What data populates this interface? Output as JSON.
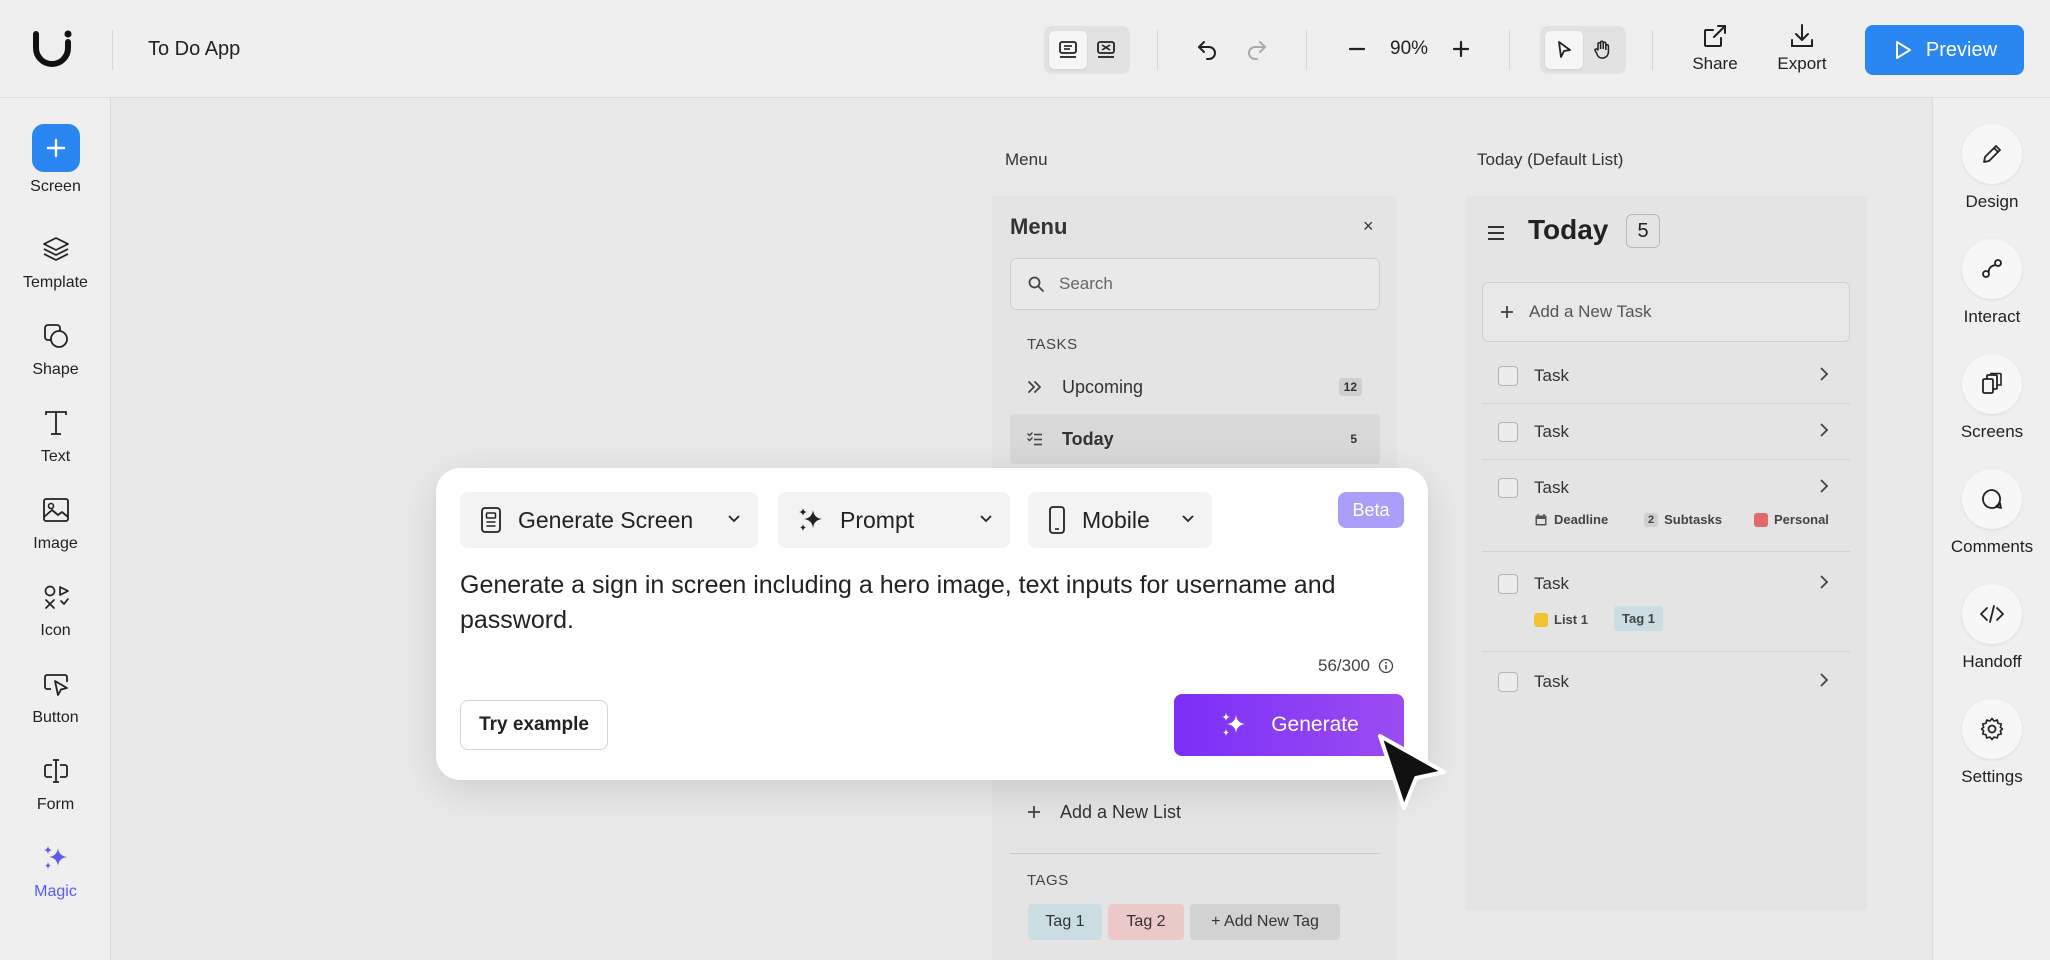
{
  "app": {
    "project_title": "To Do App"
  },
  "toolbar": {
    "zoom": "90%",
    "share_label": "Share",
    "export_label": "Export",
    "preview_label": "Preview"
  },
  "left_tools": [
    {
      "label": "Screen",
      "icon": "plus-icon"
    },
    {
      "label": "Template",
      "icon": "layers-icon"
    },
    {
      "label": "Shape",
      "icon": "shapes-icon"
    },
    {
      "label": "Text",
      "icon": "text-icon"
    },
    {
      "label": "Image",
      "icon": "image-icon"
    },
    {
      "label": "Icon",
      "icon": "icons-icon"
    },
    {
      "label": "Button",
      "icon": "button-cursor-icon"
    },
    {
      "label": "Form",
      "icon": "form-icon"
    },
    {
      "label": "Magic",
      "icon": "magic-sparkle-icon"
    }
  ],
  "right_tools": [
    {
      "label": "Design",
      "icon": "pencil-icon"
    },
    {
      "label": "Interact",
      "icon": "interact-icon"
    },
    {
      "label": "Screens",
      "icon": "screens-icon"
    },
    {
      "label": "Comments",
      "icon": "comment-icon"
    },
    {
      "label": "Handoff",
      "icon": "code-icon"
    },
    {
      "label": "Settings",
      "icon": "gear-icon"
    }
  ],
  "canvas": {
    "menu_caption": "Menu",
    "today_caption": "Today (Default List)"
  },
  "menu_screen": {
    "title": "Menu",
    "close": "×",
    "search_placeholder": "Search",
    "tasks_label": "TASKS",
    "items": [
      {
        "label": "Upcoming",
        "count": "12"
      },
      {
        "label": "Today",
        "count": "5"
      }
    ],
    "add_list_label": "Add a New List",
    "tags_label": "TAGS",
    "tags": [
      {
        "label": "Tag 1",
        "color": "#c9dde3"
      },
      {
        "label": "Tag 2",
        "color": "#ebc9c9"
      },
      {
        "label": "+ Add New Tag",
        "color": "#d2d2d2"
      }
    ]
  },
  "today_screen": {
    "title": "Today",
    "count": "5",
    "add_task_label": "Add a New Task",
    "tasks": [
      {
        "label": "Task"
      },
      {
        "label": "Task"
      },
      {
        "label": "Task",
        "deadline": "Deadline",
        "subtask_count": "2",
        "subtasks": "Subtasks",
        "tag": "Personal",
        "tag_color": "#e26a6a"
      },
      {
        "label": "Task",
        "list": "List 1",
        "list_color": "#f2c230",
        "tag": "Tag 1"
      },
      {
        "label": "Task"
      }
    ]
  },
  "generate_dialog": {
    "mode": "Generate Screen",
    "input_type": "Prompt",
    "device": "Mobile",
    "beta": "Beta",
    "prompt": "Generate a sign in screen including a hero image, text inputs for username and password.",
    "char_count": "56/300",
    "try_example": "Try example",
    "generate": "Generate"
  },
  "colors": {
    "accent_blue": "#2a86f0",
    "generate_purple": "#8a3cf4",
    "beta_purple": "#a99ff8"
  }
}
